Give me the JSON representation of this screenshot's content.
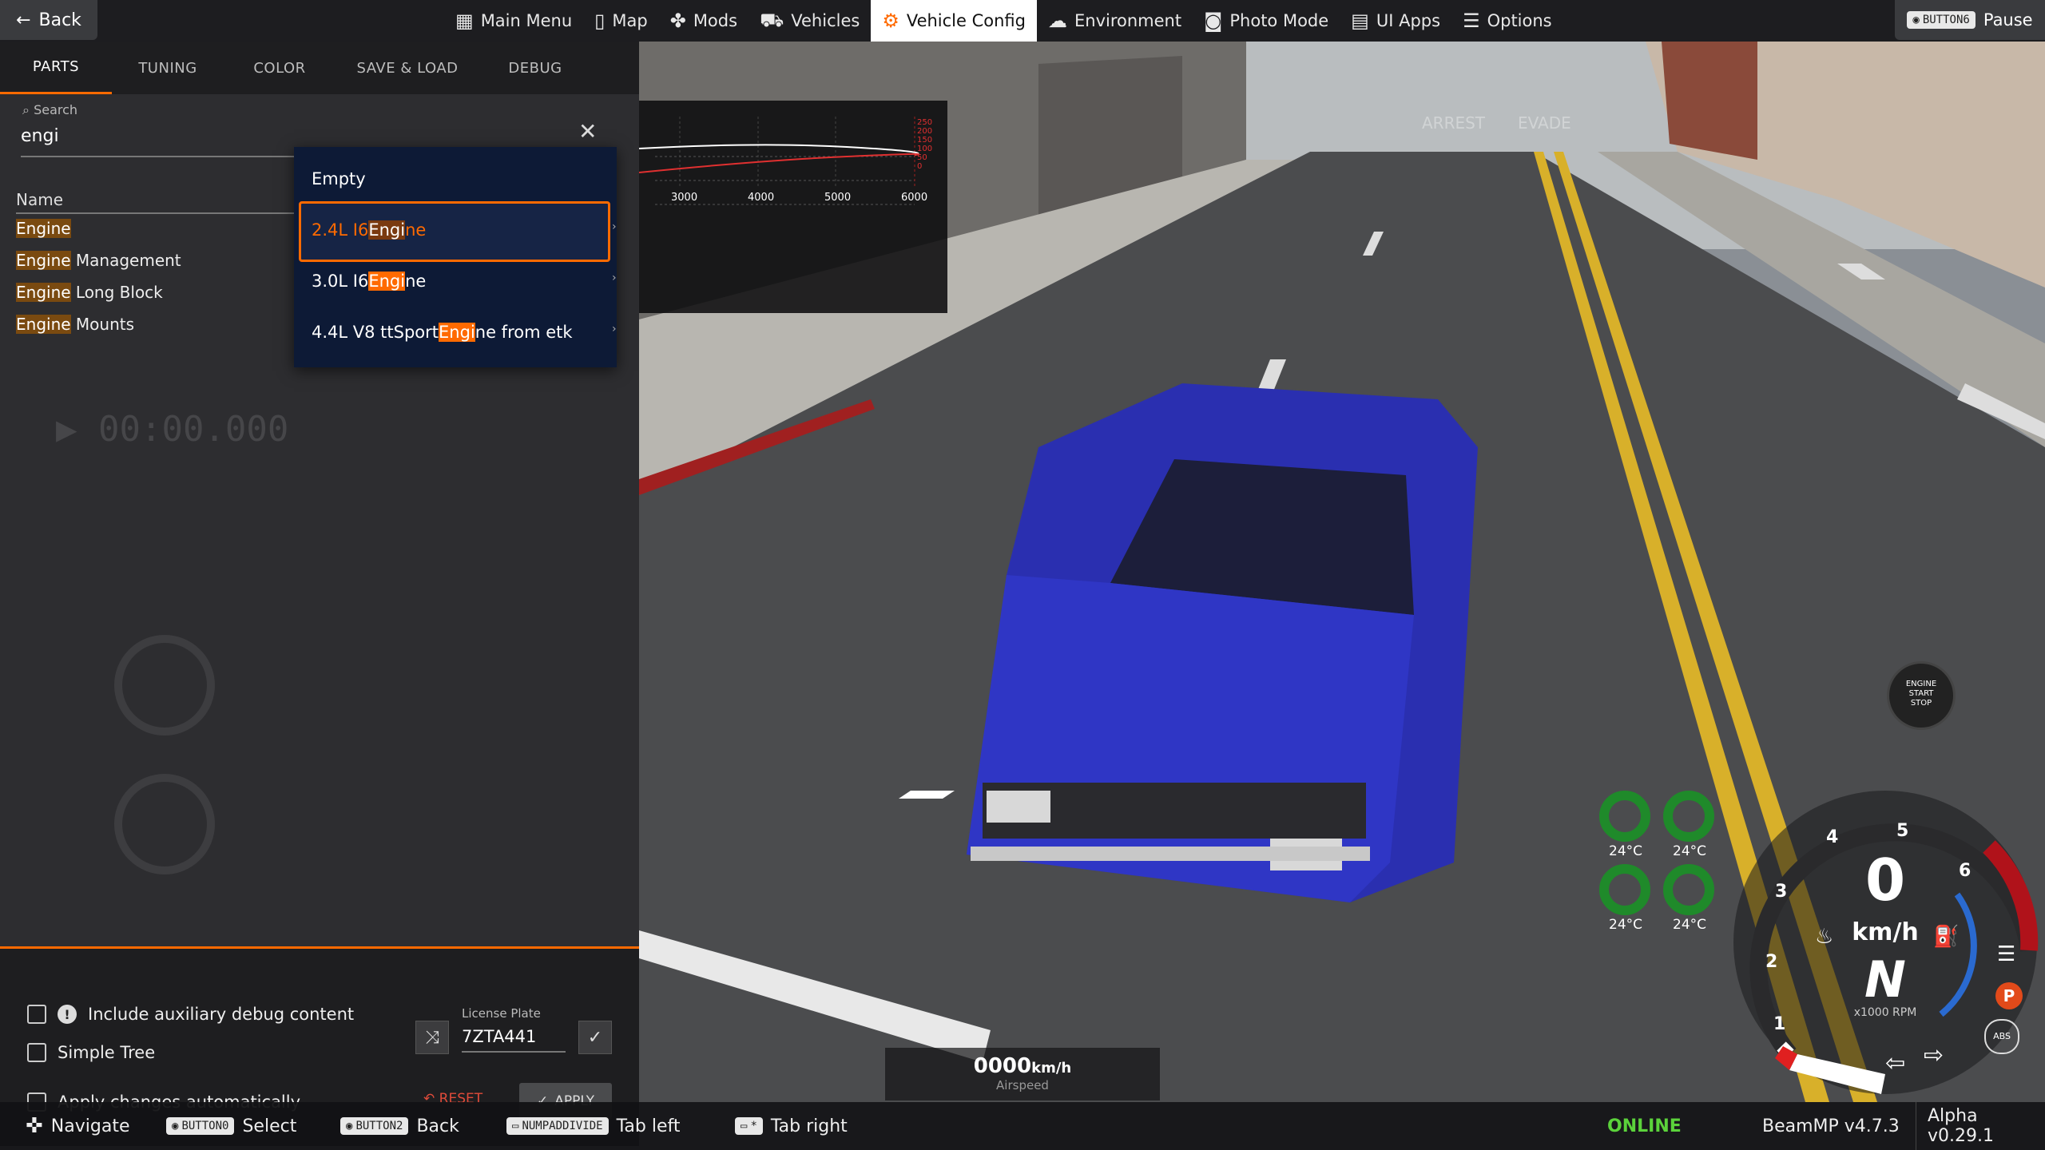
{
  "topbar": {
    "back_label": "Back",
    "menu": [
      {
        "label": "Main Menu",
        "icon": "main-menu-icon"
      },
      {
        "label": "Map",
        "icon": "map-icon"
      },
      {
        "label": "Mods",
        "icon": "puzzle-icon"
      },
      {
        "label": "Vehicles",
        "icon": "car-icon"
      },
      {
        "label": "Vehicle Config",
        "icon": "engine-icon",
        "active": true
      },
      {
        "label": "Environment",
        "icon": "sun-cloud-icon"
      },
      {
        "label": "Photo Mode",
        "icon": "camera-icon"
      },
      {
        "label": "UI Apps",
        "icon": "ui-apps-icon"
      },
      {
        "label": "Options",
        "icon": "options-icon"
      }
    ],
    "pause_key": "BUTTON6",
    "pause_label": "Pause"
  },
  "panel": {
    "tabs": [
      "PARTS",
      "TUNING",
      "COLOR",
      "SAVE & LOAD",
      "DEBUG"
    ],
    "active_tab": "PARTS",
    "search_label": "Search",
    "search_value": "engi",
    "name_header": "Name",
    "parts": [
      {
        "match": "Engine",
        "rest": ""
      },
      {
        "match": "Engine",
        "rest": " Management"
      },
      {
        "match": "Engine",
        "rest": " Long Block"
      },
      {
        "match": "Engine",
        "rest": " Mounts"
      }
    ],
    "options": {
      "aux_debug": "Include auxiliary debug content",
      "simple_tree": "Simple Tree",
      "apply_auto": "Apply changes automatically"
    },
    "license_plate_label": "License Plate",
    "license_plate_value": "7ZTA441",
    "reset_label": "RESET",
    "apply_label": "APPLY"
  },
  "dropdown": {
    "options": [
      {
        "pre": "Empty",
        "match": "",
        "post": ""
      },
      {
        "pre": "2.4L I6",
        "match": "Engi",
        "post": "ne",
        "selected": true
      },
      {
        "pre": "3.0L I6",
        "match": "Engi",
        "post": "ne"
      },
      {
        "pre": "4.4L V8 ttSport",
        "match": "Engi",
        "post": "ne from etk"
      }
    ]
  },
  "graph": {
    "x_ticks": [
      "3000",
      "4000",
      "5000",
      "6000"
    ],
    "y_ticks": [
      "250",
      "200",
      "150",
      "100",
      "50",
      "0"
    ]
  },
  "hud": {
    "temps": [
      "24°C",
      "24°C",
      "24°C",
      "24°C"
    ],
    "speed": "0",
    "speed_unit": "km/h",
    "gear": "N",
    "rpm_label": "x1000 RPM",
    "gear_marks": [
      "1",
      "2",
      "3",
      "4",
      "5",
      "6"
    ],
    "engine_btn": [
      "ENGINE",
      "START",
      "STOP"
    ],
    "parking": "P",
    "abs": "ABS",
    "airspeed_value": "0000",
    "airspeed_unit": "km/h",
    "airspeed_label": "Airspeed"
  },
  "scene_text": {
    "arrest": "ARREST",
    "evade": "EVADE"
  },
  "bottombar": {
    "navigate": "Navigate",
    "select_key": "BUTTON0",
    "select": "Select",
    "back_key": "BUTTON2",
    "back": "Back",
    "tab_left_key": "NUMPADDIVIDE",
    "tab_left": "Tab left",
    "tab_right_key": "*",
    "tab_right": "Tab right",
    "status": "ONLINE",
    "beammp": "BeamMP v4.7.3",
    "version": "Alpha v0.29.1"
  },
  "colors": {
    "accent": "#ff6a00",
    "car": "#2a2fb0",
    "online": "#5bd23b",
    "dropdown_bg": "#0d1a36"
  }
}
